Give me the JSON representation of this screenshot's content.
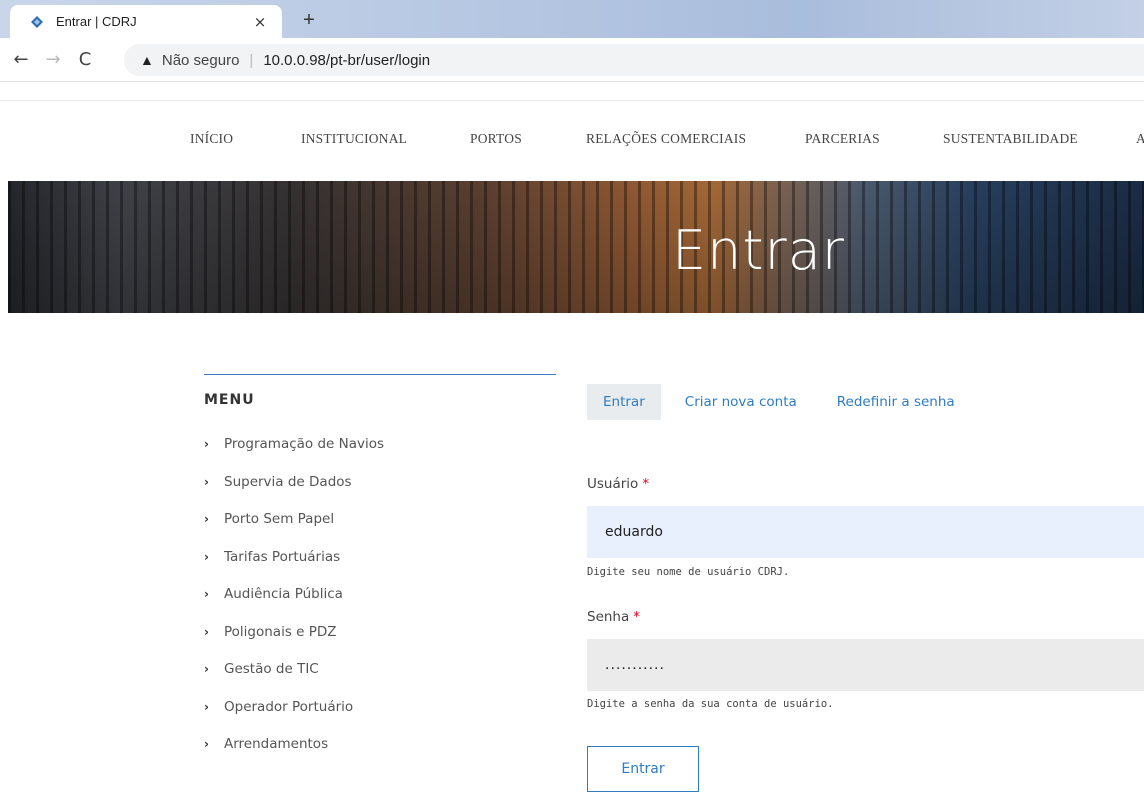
{
  "browser": {
    "tab_title": "Entrar | CDRJ",
    "close_glyph": "×",
    "new_tab_glyph": "+",
    "back_glyph": "←",
    "forward_glyph": "→",
    "reload_glyph": "C",
    "warning_glyph": "▲",
    "security_text": "Não seguro",
    "separator": "|",
    "url": "10.0.0.98/pt-br/user/login"
  },
  "site_nav": {
    "items": [
      "INÍCIO",
      "INSTITUCIONAL",
      "PORTOS",
      "RELAÇÕES COMERCIAIS",
      "PARCERIAS",
      "SUSTENTABILIDADE",
      "A"
    ]
  },
  "hero": {
    "title": "Entrar"
  },
  "sidebar": {
    "title": "MENU",
    "chevron": "›",
    "items": [
      "Programação de Navios",
      "Supervia de Dados",
      "Porto Sem Papel",
      "Tarifas Portuárias",
      "Audiência Pública",
      "Poligonais e PDZ",
      "Gestão de TIC",
      "Operador Portuário",
      "Arrendamentos"
    ]
  },
  "login_tabs": [
    "Entrar",
    "Criar nova conta",
    "Redefinir a senha"
  ],
  "form": {
    "user_label": "Usuário",
    "required_mark": "*",
    "user_value": "eduardo",
    "user_help": "Digite seu nome de usuário CDRJ.",
    "pass_label": "Senha",
    "pass_value": "...........",
    "pass_help": "Digite a senha da sua conta de usuário.",
    "submit_label": "Entrar"
  },
  "colors": {
    "accent": "#2f7cc1",
    "required": "#e0001b",
    "autofill": "#e8f0fe"
  },
  "icons": {
    "favicon": "cdrj-logo-icon",
    "warning": "warning-triangle-icon"
  }
}
